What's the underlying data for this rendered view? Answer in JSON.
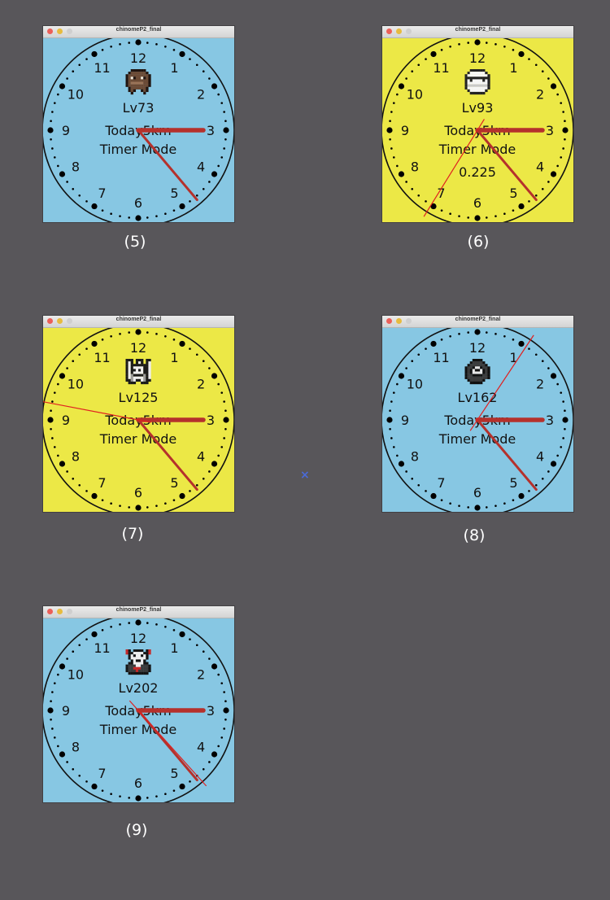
{
  "windows": [
    {
      "id": "5",
      "title": "chinomeP2_final",
      "bg": "#87c7e3",
      "avatar": "brown-monster",
      "level": "Lv73",
      "today": "Today5km",
      "mode": "Timer Mode",
      "extra": "",
      "sec": null
    },
    {
      "id": "6",
      "title": "chinomeP2_final",
      "bg": "#ece846",
      "avatar": "white-ghost",
      "level": "Lv93",
      "today": "Today5km",
      "mode": "Timer Mode",
      "extra": "0.225",
      "sec": 35.3
    },
    {
      "id": "7",
      "title": "chinomeP2_final",
      "bg": "#ece846",
      "avatar": "skeleton",
      "level": "Lv125",
      "today": "Today5km",
      "mode": "Timer Mode",
      "extra": "",
      "sec": 46.8
    },
    {
      "id": "8",
      "title": "chinomeP2_final",
      "bg": "#87c7e3",
      "avatar": "dark-knight",
      "level": "Lv162",
      "today": "Today5km",
      "mode": "Timer Mode",
      "extra": "",
      "sec": 5.6
    },
    {
      "id": "9",
      "title": "chinomeP2_final",
      "bg": "#87c7e3",
      "avatar": "skull-reaper",
      "level": "Lv202",
      "today": "Today5km",
      "mode": "Timer Mode",
      "extra": "",
      "sec": 23.0
    }
  ],
  "captions": [
    "(5)",
    "(6)",
    "(7)",
    "(8)",
    "(9)"
  ],
  "clock": {
    "numerals": [
      "12",
      "1",
      "2",
      "3",
      "4",
      "5",
      "6",
      "7",
      "8",
      "9",
      "10",
      "11"
    ],
    "hour_hand_hour": 3,
    "minute_hand_minute": 23.3,
    "hand_color": "#b5312c",
    "second_color": "#e02020"
  },
  "marker": "×"
}
